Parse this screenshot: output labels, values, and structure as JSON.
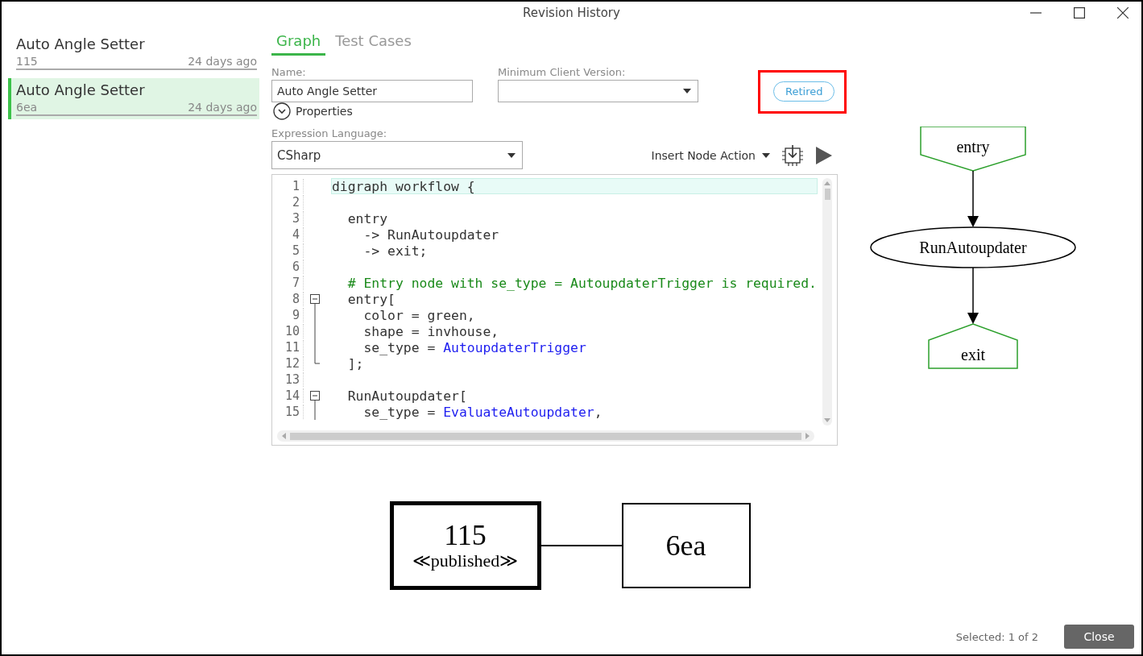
{
  "window": {
    "title": "Revision History"
  },
  "revisions": [
    {
      "name": "Auto Angle Setter",
      "id": "115",
      "age": "24 days ago",
      "selected": false
    },
    {
      "name": "Auto Angle Setter",
      "id": "6ea",
      "age": "24 days ago",
      "selected": true
    }
  ],
  "tabs": [
    {
      "label": "Graph",
      "selected": true
    },
    {
      "label": "Test Cases",
      "selected": false
    }
  ],
  "name_field": {
    "label": "Name:",
    "value": "Auto Angle Setter"
  },
  "client_version_field": {
    "label": "Minimum Client Version:"
  },
  "status_badge": {
    "label": "Retired",
    "highlighted": true
  },
  "properties": {
    "label": "Properties",
    "expanded": false
  },
  "language_field": {
    "label": "Expression Language:",
    "value": "CSharp"
  },
  "insert_node_action": {
    "label": "Insert Node Action"
  },
  "editor": {
    "lines": [
      {
        "num": "1",
        "current": true,
        "collapsible": false,
        "in_fold": false,
        "fold_end": false,
        "segments": [
          {
            "text": "digraph workflow {",
            "kind": "plain"
          }
        ]
      },
      {
        "num": "2",
        "current": false,
        "collapsible": false,
        "in_fold": false,
        "fold_end": false
      },
      {
        "num": "3",
        "current": false,
        "collapsible": false,
        "in_fold": false,
        "fold_end": false,
        "segments": [
          {
            "text": "  entry",
            "kind": "plain"
          }
        ]
      },
      {
        "num": "4",
        "current": false,
        "collapsible": false,
        "in_fold": false,
        "fold_end": false,
        "segments": [
          {
            "text": "    -> RunAutoupdater",
            "kind": "plain"
          }
        ]
      },
      {
        "num": "5",
        "current": false,
        "collapsible": false,
        "in_fold": false,
        "fold_end": false,
        "segments": [
          {
            "text": "    -> exit;",
            "kind": "plain"
          }
        ]
      },
      {
        "num": "6",
        "current": false,
        "collapsible": false,
        "in_fold": false,
        "fold_end": false
      },
      {
        "num": "7",
        "current": false,
        "collapsible": false,
        "in_fold": false,
        "fold_end": false,
        "segments": [
          {
            "text": "  # Entry node with se_type = AutoupdaterTrigger is required.",
            "kind": "comment"
          }
        ]
      },
      {
        "num": "8",
        "current": false,
        "collapsible": true,
        "in_fold": false,
        "fold_end": false,
        "segments": [
          {
            "text": "  entry[",
            "kind": "plain"
          }
        ]
      },
      {
        "num": "9",
        "current": false,
        "collapsible": false,
        "in_fold": true,
        "fold_end": false,
        "segments": [
          {
            "text": "    color = green,",
            "kind": "plain"
          }
        ]
      },
      {
        "num": "10",
        "current": false,
        "collapsible": false,
        "in_fold": true,
        "fold_end": false,
        "segments": [
          {
            "text": "    shape = invhouse,",
            "kind": "plain"
          }
        ]
      },
      {
        "num": "11",
        "current": false,
        "collapsible": false,
        "in_fold": true,
        "fold_end": false,
        "segments": [
          {
            "text": "    se_type = ",
            "kind": "plain"
          },
          {
            "text": "AutoupdaterTrigger",
            "kind": "keyword"
          }
        ]
      },
      {
        "num": "12",
        "current": false,
        "collapsible": false,
        "in_fold": false,
        "fold_end": true,
        "segments": [
          {
            "text": "  ];",
            "kind": "plain"
          }
        ]
      },
      {
        "num": "13",
        "current": false,
        "collapsible": false,
        "in_fold": false,
        "fold_end": false
      },
      {
        "num": "14",
        "current": false,
        "collapsible": true,
        "in_fold": false,
        "fold_end": false,
        "segments": [
          {
            "text": "  RunAutoupdater[",
            "kind": "plain"
          }
        ]
      },
      {
        "num": "15",
        "current": false,
        "collapsible": false,
        "in_fold": true,
        "fold_end": false,
        "segments": [
          {
            "text": "    se_type = ",
            "kind": "plain"
          },
          {
            "text": "EvaluateAutoupdater",
            "kind": "keyword"
          },
          {
            "text": ",",
            "kind": "plain"
          }
        ]
      }
    ]
  },
  "workflow_graph": {
    "nodes": [
      {
        "label": "entry",
        "kind": "invhouse",
        "color": "#2ca02c"
      },
      {
        "label": "RunAutoupdater",
        "kind": "ellipse",
        "color": "#000000"
      },
      {
        "label": "exit",
        "kind": "house",
        "color": "#2ca02c"
      }
    ]
  },
  "version_graph": {
    "nodes": [
      {
        "label": "115",
        "stereotype": "≪published≫",
        "emphasized": true
      },
      {
        "label": "6ea",
        "emphasized": false
      }
    ]
  },
  "footer": {
    "selection": "Selected: 1 of 2",
    "close_button": "Close"
  }
}
